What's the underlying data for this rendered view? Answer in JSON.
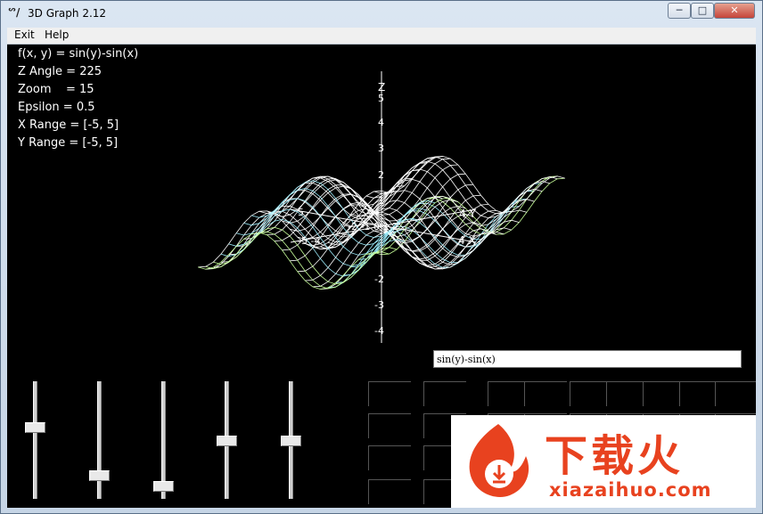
{
  "window": {
    "app_icon": "ᔥ/",
    "title": "3D Graph 2.12",
    "controls": {
      "minimize": "─",
      "maximize": "□",
      "close": "✕"
    }
  },
  "menu": [
    "Exit",
    "Help"
  ],
  "info": {
    "function": "f(x, y) = sin(y)-sin(x)",
    "z_angle": "Z Angle = 225",
    "zoom": "Zoom    = 15",
    "epsilon": "Epsilon = 0.5",
    "x_range": "X Range = [-5, 5]",
    "y_range": "Y Range = [-5, 5]"
  },
  "axis_labels": {
    "z": [
      "Z",
      "5",
      "4",
      "3",
      "2",
      "1"
    ],
    "z_neg": [
      "-2",
      "-3",
      "-4"
    ],
    "x_right": "4 X",
    "y_right": "4 Y",
    "left_a": "5",
    "left_b": "-5 -4",
    "mid": "-2 -1 0 1 2"
  },
  "function_input": {
    "value": "sin(y)-sin(x)"
  },
  "sliders": [
    {
      "name": "slider-1",
      "level": 0.38
    },
    {
      "name": "slider-2",
      "level": 0.82
    },
    {
      "name": "slider-3",
      "level": 0.92
    },
    {
      "name": "slider-4",
      "level": 0.5
    },
    {
      "name": "slider-5",
      "level": 0.5
    }
  ],
  "watermark": {
    "logo_icon": "fire-download-icon",
    "text": "下载火",
    "domain": "xiazaihuo.com",
    "color": "#e8421f"
  }
}
